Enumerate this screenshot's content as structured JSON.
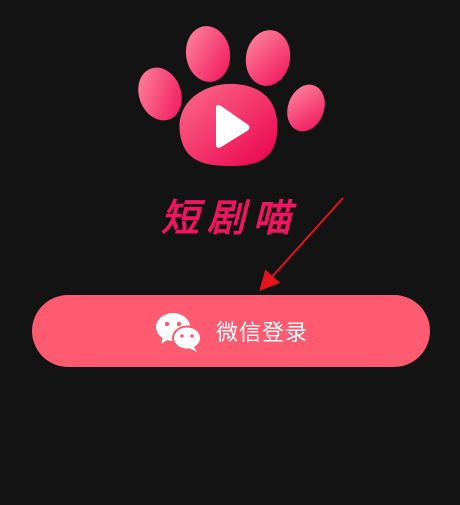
{
  "app": {
    "name": "短剧喵",
    "logo_icon": "paw-play-icon"
  },
  "login": {
    "label": "微信登录",
    "icon": "wechat-icon"
  },
  "colors": {
    "background": "#131313",
    "brand": "#f01560",
    "button": "#fe5b70"
  }
}
